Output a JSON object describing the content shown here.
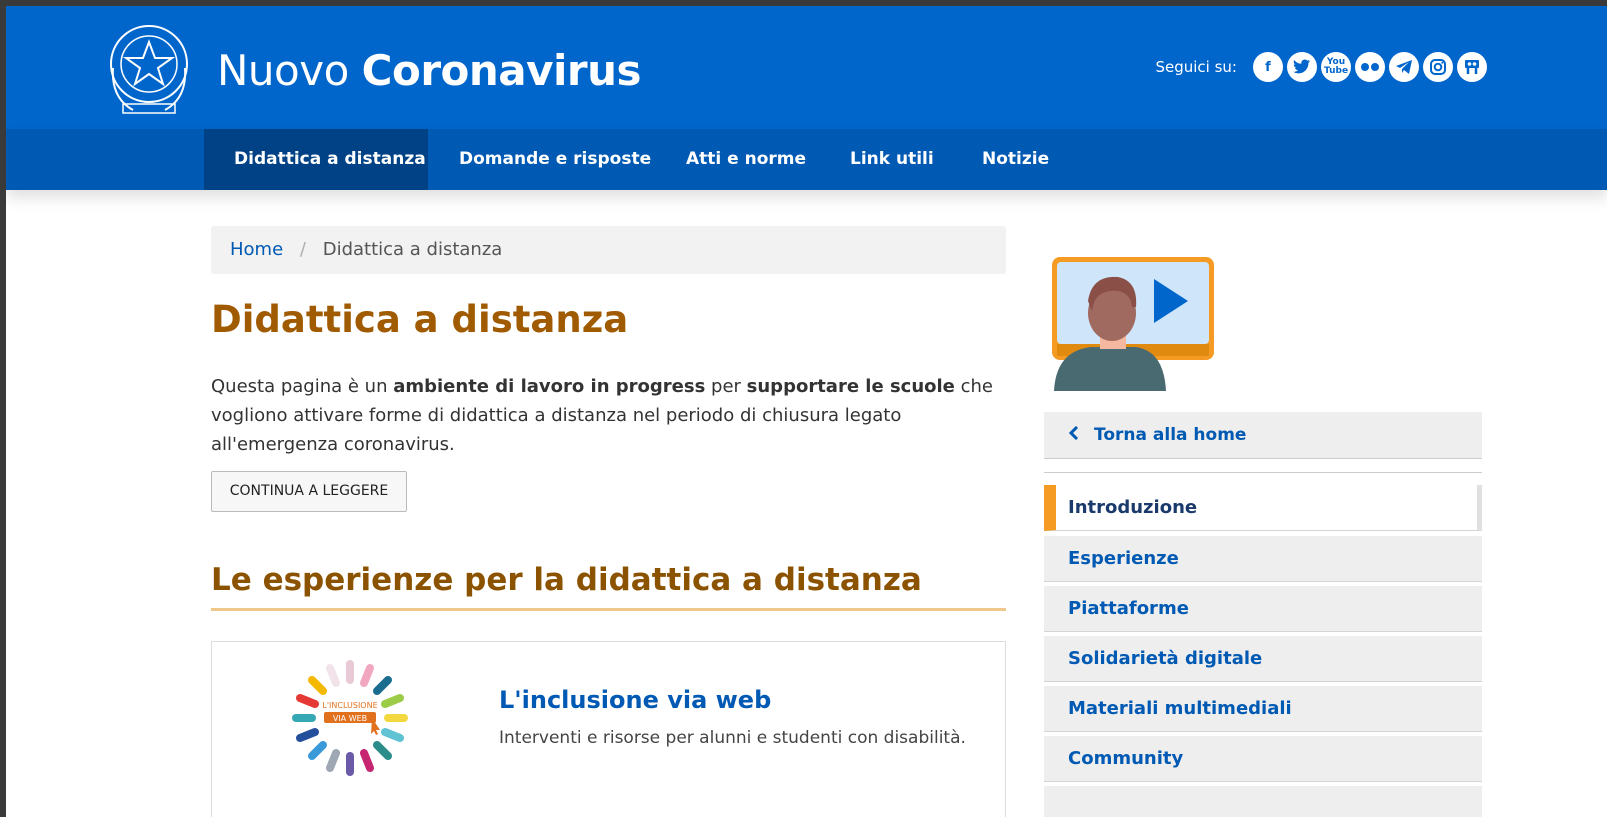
{
  "header": {
    "title_light": "Nuovo",
    "title_bold": "Coronavirus",
    "social_label": "Seguici su:",
    "social_icons": [
      "facebook-icon",
      "twitter-icon",
      "youtube-icon",
      "flickr-icon",
      "telegram-icon",
      "instagram-icon",
      "slideshare-icon"
    ]
  },
  "nav": {
    "items": [
      {
        "label": "Didattica a distanza",
        "active": true
      },
      {
        "label": "Domande e risposte"
      },
      {
        "label": "Atti e norme"
      },
      {
        "label": "Link utili"
      },
      {
        "label": "Notizie"
      }
    ]
  },
  "breadcrumb": {
    "home": "Home",
    "separator": "/",
    "current": "Didattica a distanza"
  },
  "main": {
    "title": "Didattica a distanza",
    "intro_1": "Questa pagina è un ",
    "intro_bold_1": "ambiente di lavoro in progress",
    "intro_2": " per ",
    "intro_bold_2": "supportare le scuole",
    "intro_3": " che vogliono attivare forme di didattica a distanza nel periodo di chiusura legato all'emergenza coronavirus.",
    "continue_button": "CONTINUA A LEGGERE",
    "section_title": "Le esperienze per la didattica a distanza",
    "card": {
      "logo_line1": "L'INCLUSIONE",
      "logo_line2": "VIA WEB",
      "title": "L'inclusione via web",
      "description": "Interventi e risorse per alunni e studenti con disabilità."
    }
  },
  "sidebar": {
    "back_label": "Torna alla home",
    "items": [
      {
        "label": "Introduzione",
        "active": true
      },
      {
        "label": "Esperienze"
      },
      {
        "label": "Piattaforme"
      },
      {
        "label": "Solidarietà digitale"
      },
      {
        "label": "Materiali multimediali"
      },
      {
        "label": "Community"
      }
    ]
  },
  "colors": {
    "header_blue": "#0066cc",
    "nav_blue": "#0059b3",
    "nav_active": "#004285",
    "title_orange": "#a05a00",
    "accent_orange": "#f59a23"
  }
}
